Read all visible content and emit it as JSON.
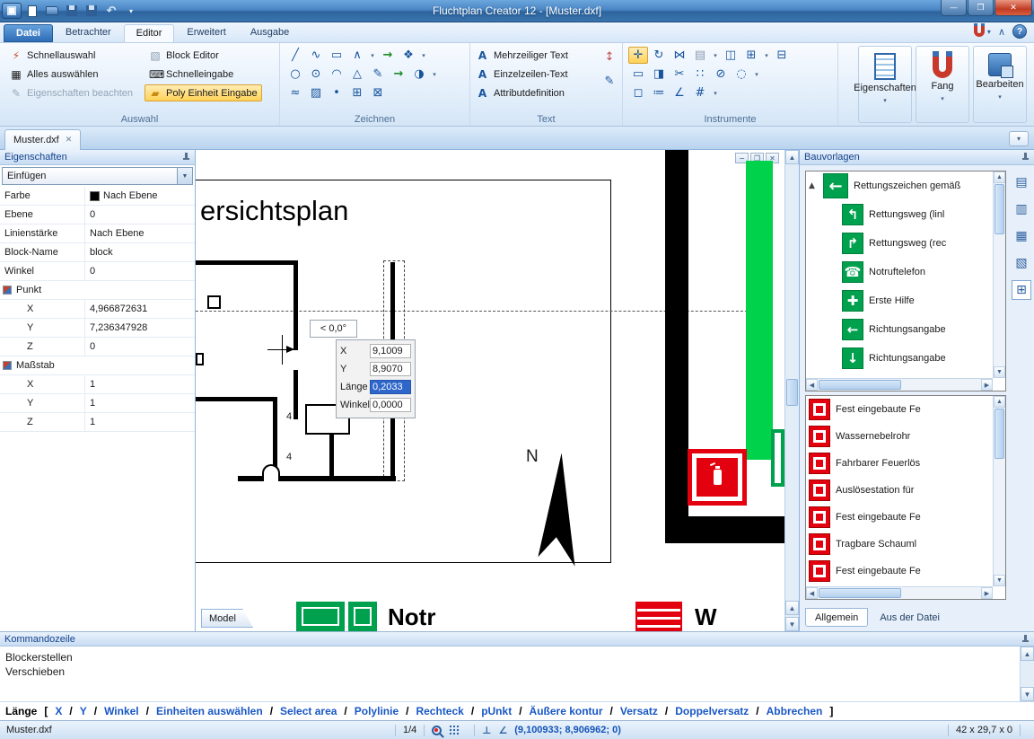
{
  "window": {
    "title": "Fluchtplan Creator 12 - [Muster.dxf]"
  },
  "menu_tabs": [
    {
      "label": "Datei"
    },
    {
      "label": "Betrachter"
    },
    {
      "label": "Editor"
    },
    {
      "label": "Erweitert"
    },
    {
      "label": "Ausgabe"
    }
  ],
  "ribbon": {
    "auswahl": {
      "caption": "Auswahl",
      "items": [
        {
          "label": "Schnellauswahl"
        },
        {
          "label": "Alles auswählen"
        },
        {
          "label": "Eigenschaften beachten"
        },
        {
          "label": "Block Editor"
        },
        {
          "label": "Schnelleingabe"
        },
        {
          "label": "Poly Einheit Eingabe"
        }
      ]
    },
    "zeichnen": {
      "caption": "Zeichnen"
    },
    "text_group": {
      "caption": "Text",
      "items": [
        {
          "label": "Mehrzeiliger Text"
        },
        {
          "label": "Einzelzeilen-Text"
        },
        {
          "label": "Attributdefinition"
        }
      ]
    },
    "instrumente": {
      "caption": "Instrumente"
    },
    "big_buttons": [
      {
        "label": "Eigenschaften"
      },
      {
        "label": "Fang"
      },
      {
        "label": "Bearbeiten"
      }
    ]
  },
  "document_tab": {
    "label": "Muster.dxf"
  },
  "properties": {
    "title": "Eigenschaften",
    "mode": "Einfügen",
    "rows": [
      {
        "label": "Farbe",
        "value": "Nach Ebene"
      },
      {
        "label": "Ebene",
        "value": "0"
      },
      {
        "label": "Linienstärke",
        "value": "Nach Ebene"
      },
      {
        "label": "Block-Name",
        "value": "block"
      },
      {
        "label": "Winkel",
        "value": "0"
      },
      {
        "label": "Punkt",
        "value": ""
      },
      {
        "label": "X",
        "value": "4,966872631"
      },
      {
        "label": "Y",
        "value": "7,236347928"
      },
      {
        "label": "Z",
        "value": "0"
      },
      {
        "label": "Maßstab",
        "value": ""
      },
      {
        "label": "X",
        "value": "1"
      },
      {
        "label": "Y",
        "value": "1"
      },
      {
        "label": "Z",
        "value": "1"
      }
    ]
  },
  "canvas": {
    "plan_title": "ersichtsplan",
    "north_letter": "N",
    "room_label_a": "4",
    "room_label_b": "4",
    "angle_tip": "< 0,0°",
    "input_fields": [
      {
        "label": "X",
        "value": "9,1009"
      },
      {
        "label": "Y",
        "value": "8,9070"
      },
      {
        "label": "Länge",
        "value": "0,2033"
      },
      {
        "label": "Winkel",
        "value": "0,0000"
      }
    ],
    "legend_text_a": "Notr",
    "legend_text_b": "W",
    "model_tab": "Model"
  },
  "templates": {
    "title": "Bauvorlagen",
    "rescue_items": [
      {
        "label": "Rettungszeichen gemäß",
        "icon": "exit-arrow-left",
        "glyph": "←"
      },
      {
        "label": "Rettungsweg (linl",
        "icon": "running-man-left",
        "glyph": "↰"
      },
      {
        "label": "Rettungsweg (rec",
        "icon": "running-man-right",
        "glyph": "↱"
      },
      {
        "label": "Notruftelefon",
        "icon": "emergency-phone",
        "glyph": "☎"
      },
      {
        "label": "Erste Hilfe",
        "icon": "first-aid-cross",
        "glyph": "✚"
      },
      {
        "label": "Richtungsangabe",
        "icon": "direction-arrow-left",
        "glyph": "←"
      },
      {
        "label": "Richtungsangabe",
        "icon": "direction-arrow-down",
        "glyph": "↓"
      }
    ],
    "fire_items": [
      {
        "label": "Fest eingebaute Fe",
        "icon": "fire-equipment"
      },
      {
        "label": "Wassernebelrohr",
        "icon": "water-mist-pipe"
      },
      {
        "label": "Fahrbarer Feuerlös",
        "icon": "mobile-extinguisher"
      },
      {
        "label": "Auslösestation für",
        "icon": "release-station"
      },
      {
        "label": "Fest eingebaute Fe",
        "icon": "fire-equipment"
      },
      {
        "label": "Tragbare Schauml",
        "icon": "foam-extinguisher"
      },
      {
        "label": "Fest eingebaute Fe",
        "icon": "fire-equipment"
      }
    ],
    "tabs": [
      {
        "label": "Allgemein"
      },
      {
        "label": "Aus der Datei"
      }
    ]
  },
  "command": {
    "title": "Kommandozeile",
    "lines": [
      {
        "text": "Blockerstellen"
      },
      {
        "text": "Verschieben"
      }
    ],
    "prompt": "Länge",
    "bracket_open": "[",
    "bracket_close": "]",
    "options": [
      {
        "label": "X"
      },
      {
        "label": "Y"
      },
      {
        "label": "Winkel"
      },
      {
        "label": "Einheiten auswählen"
      },
      {
        "label": "Select area"
      },
      {
        "label": "Polylinie"
      },
      {
        "label": "Rechteck"
      },
      {
        "label": "pUnkt"
      },
      {
        "label": "Äußere kontur"
      },
      {
        "label": "Versatz"
      },
      {
        "label": "Doppelversatz"
      },
      {
        "label": "Abbrechen"
      }
    ]
  },
  "status": {
    "file": "Muster.dxf",
    "page": "1/4",
    "coords": "(9,100933; 8,906962; 0)",
    "sheet": "42 x 29,7 x 0"
  }
}
